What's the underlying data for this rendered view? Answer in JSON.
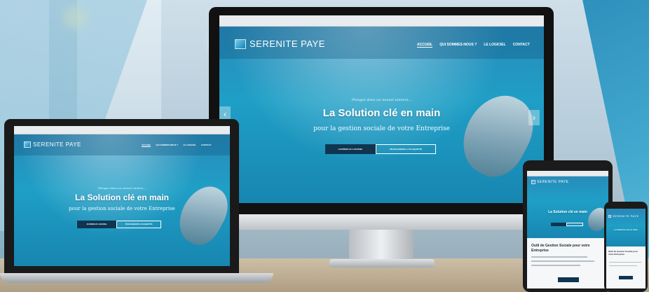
{
  "brand": {
    "logo_text": "SERENITE PAYE"
  },
  "nav": {
    "items": [
      "ACCUEIL",
      "QUI SOMMES-NOUS ?",
      "LE LOGICIEL",
      "CONTACT"
    ]
  },
  "hero": {
    "tagline": "Plongez dans un nouvel univers...",
    "headline": "La Solution clé en main",
    "subheadline": "pour la gestion sociale de votre Entreprise",
    "primary_button": "ACCÉDER AU LOGICIEL",
    "secondary_button": "TÉLÉCHARGER LA PLAQUETTE"
  },
  "carousel": {
    "prev_icon": "chevron-left-icon",
    "next_icon": "chevron-right-icon"
  },
  "mobile_section": {
    "title": "Outil de Gestion Sociale pour votre Entreprise"
  },
  "colors": {
    "accent": "#1786b1",
    "button_dark": "#0f3550",
    "wedge": "#1a86b6"
  }
}
